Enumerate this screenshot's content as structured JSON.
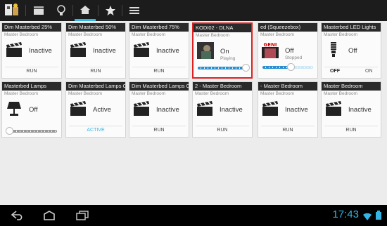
{
  "topbar": {
    "tabs": [
      {
        "name": "app-logo-icon"
      },
      {
        "name": "scenes-icon"
      },
      {
        "name": "bulb-icon"
      },
      {
        "name": "rooms-icon",
        "active": true
      },
      {
        "name": "star-icon"
      },
      {
        "name": "list-icon"
      }
    ]
  },
  "tiles": [
    {
      "title": "Dim Masterbed 25%",
      "room": "Master Bedroom",
      "status": "Inactive",
      "action": "RUN",
      "icon": "clapper-icon"
    },
    {
      "title": "Dim Masterbed 50%",
      "room": "Master Bedroom",
      "status": "Inactive",
      "action": "RUN",
      "icon": "clapper-icon"
    },
    {
      "title": "Dim Masterbed 75%",
      "room": "Master Bedroom",
      "status": "Inactive",
      "action": "RUN",
      "icon": "clapper-icon"
    },
    {
      "title": "KODI02 - DLNA",
      "room": "Master Bedroom",
      "status": "On",
      "sub": "Playing",
      "icon": "album-art-icon",
      "slider": 0.95,
      "highlight": true
    },
    {
      "title": "ed (Squeezebox)",
      "room": "Master Bedroom",
      "status": "Off",
      "sub": "Stopped",
      "icon": "album-art-genius-icon",
      "slider": 0.55
    },
    {
      "title": "Masterbed LED Lights",
      "room": "Master Bedroom",
      "status": "Off",
      "off": "OFF",
      "on": "ON",
      "icon": "cfl-bulb-icon"
    },
    {
      "title": "Masterbed Lamps",
      "room": "Master Bedroom",
      "status": "Off",
      "icon": "lamp-icon",
      "slider": 0.05,
      "gray": true
    },
    {
      "title": "Dim Masterbed Lamps Off",
      "room": "Master Bedroom",
      "status": "Active",
      "action": "ACTIVE",
      "blue": true,
      "icon": "clapper-icon"
    },
    {
      "title": "Dim Masterbed Lamps On",
      "room": "Master Bedroom",
      "status": "Inactive",
      "action": "RUN",
      "icon": "clapper-icon"
    },
    {
      "title": "2 - Master Bedroom",
      "room": "Master Bedroom",
      "status": "Inactive",
      "action": "RUN",
      "icon": "clapper-icon"
    },
    {
      "title": "- Master Bedroom",
      "room": "Master Bedroom",
      "status": "Inactive",
      "action": "RUN",
      "icon": "clapper-icon"
    },
    {
      "title": "Master Bedroom",
      "room": "Master Bedroom",
      "status": "Inactive",
      "action": "RUN",
      "icon": "clapper-icon"
    }
  ],
  "navbar": {
    "time": "17:43"
  },
  "colors": {
    "accent": "#33b5e5",
    "highlight": "#e02020",
    "title_bar": "#2a2a2a"
  }
}
